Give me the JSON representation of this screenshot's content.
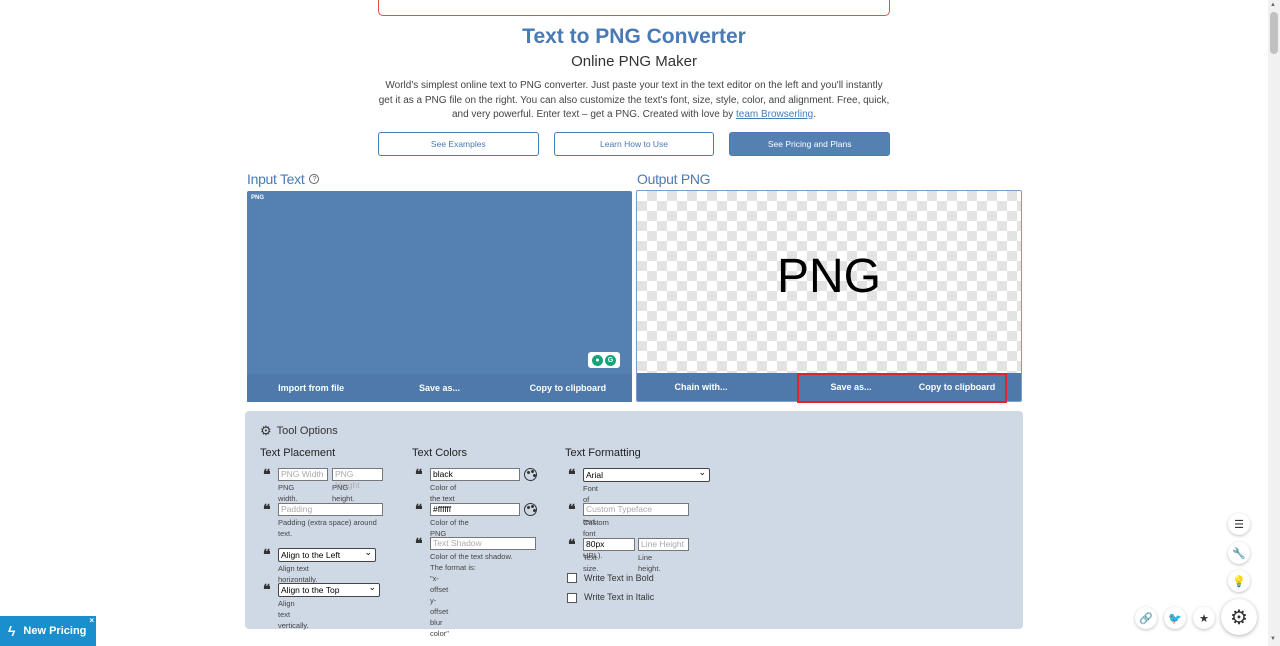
{
  "header": {
    "title": "Text to PNG Converter",
    "subtitle": "Online PNG Maker",
    "intro_text": "World's simplest online text to PNG converter. Just paste your text in the text editor on the left and you'll instantly get it as a PNG file on the right. You can also customize the text's font, size, style, color, and alignment. Free, quick, and very powerful. Enter text – get a PNG. Created with love by ",
    "intro_link": "team Browserling",
    "intro_end": "."
  },
  "actions": {
    "examples": "See Examples",
    "howto": "Learn How to Use",
    "pricing": "See Pricing and Plans"
  },
  "input": {
    "title": "Input Text",
    "help": "?",
    "value": "PNG",
    "buttons": [
      "Import from file",
      "Save as...",
      "Copy to clipboard"
    ]
  },
  "output": {
    "title": "Output PNG",
    "preview_text": "PNG",
    "buttons": [
      "Chain with...",
      "Save as...",
      "Copy to clipboard"
    ]
  },
  "tool_options": {
    "title": "Tool Options",
    "placement": {
      "title": "Text Placement",
      "width_placeholder": "PNG Width",
      "height_placeholder": "PNG Height",
      "width_desc": "PNG width.",
      "height_desc": "PNG height.",
      "padding_placeholder": "Padding",
      "padding_desc": "Padding (extra space) around text.",
      "halign_value": "Align to the Left",
      "halign_desc": "Align text horizontally.",
      "valign_value": "Align to the Top",
      "valign_desc": "Align text vertically."
    },
    "colors": {
      "title": "Text Colors",
      "text_color_value": "black",
      "text_color_desc": "Color of the text characters.",
      "bg_color_value": "#ffffff",
      "bg_color_desc": "Color of the PNG background.",
      "shadow_placeholder": "Text Shadow",
      "shadow_desc": "Color of the text shadow. The format is:",
      "shadow_format": "\"x-offset y-offset blur color\""
    },
    "formatting": {
      "title": "Text Formatting",
      "font_value": "Arial",
      "font_desc": "Font of the text.",
      "typeface_placeholder": "Custom Typeface",
      "typeface_desc": "Custom font (paste URL).",
      "size_value": "80px",
      "size_desc": "Text size.",
      "lineheight_placeholder": "Line Height",
      "lineheight_desc": "Line height.",
      "bold_label": "Write Text in Bold",
      "italic_label": "Write Text in Italic"
    }
  },
  "promo": {
    "label": "New Pricing",
    "close": "×"
  },
  "colors": {
    "accent": "#4a7ab5",
    "panel": "#5580b2",
    "options_bg": "#cfd9e5",
    "highlight": "#e0242a",
    "promo": "#1b8fce"
  }
}
